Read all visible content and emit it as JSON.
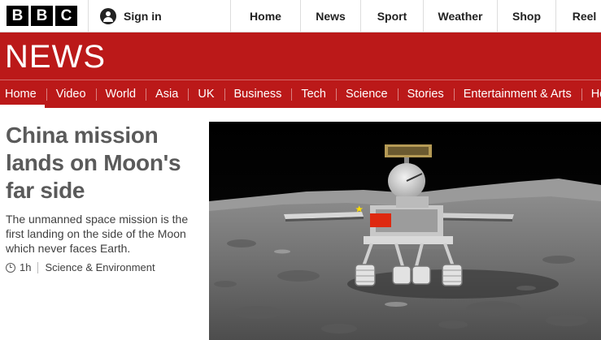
{
  "brand": {
    "logo_letters": [
      "B",
      "B",
      "C"
    ],
    "section_wordmark": "NEWS",
    "accent": "#bb1919"
  },
  "account": {
    "signin_label": "Sign in",
    "icon": "account-icon"
  },
  "top_nav": [
    {
      "label": "Home"
    },
    {
      "label": "News"
    },
    {
      "label": "Sport"
    },
    {
      "label": "Weather"
    },
    {
      "label": "Shop"
    },
    {
      "label": "Reel"
    }
  ],
  "sub_nav": [
    {
      "label": "Home",
      "active": true
    },
    {
      "label": "Video"
    },
    {
      "label": "World"
    },
    {
      "label": "Asia"
    },
    {
      "label": "UK"
    },
    {
      "label": "Business"
    },
    {
      "label": "Tech"
    },
    {
      "label": "Science"
    },
    {
      "label": "Stories"
    },
    {
      "label": "Entertainment & Arts"
    },
    {
      "label": "Health"
    }
  ],
  "article": {
    "headline": "China mission lands on Moon's far side",
    "summary": "The unmanned space mission is the first landing on the side of the Moon which never faces Earth.",
    "time": "1h",
    "time_icon": "clock-icon",
    "section": "Science & Environment",
    "image_subject": "lunar-rover-on-moon-surface"
  }
}
